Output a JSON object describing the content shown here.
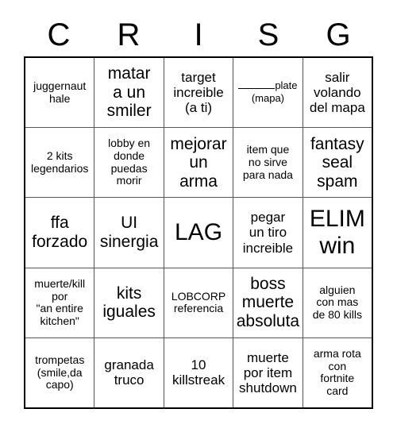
{
  "card": {
    "title_letters": [
      "C",
      "R",
      "I",
      "S",
      "G"
    ],
    "columns": 5,
    "rows": 5,
    "border_color": "#000000",
    "grid_line_color": "#555555",
    "background_color": "#ffffff",
    "text_color": "#000000",
    "cells": [
      [
        {
          "text": "juggernaut\nhale",
          "size": "sm"
        },
        {
          "text": "matar\na un\nsmiler",
          "size": "lg"
        },
        {
          "text": "target\nincreible\n(a ti)",
          "size": "md"
        },
        {
          "type": "fill-in-blank",
          "blank_suffix": "plate",
          "sub_text": "(mapa)",
          "size": "xs"
        },
        {
          "text": "salir\nvolando\ndel mapa",
          "size": "md"
        }
      ],
      [
        {
          "text": "2 kits\nlegendarios",
          "size": "sm"
        },
        {
          "text": "lobby en\ndonde\npuedas\nmorir",
          "size": "sm"
        },
        {
          "text": "mejorar\nun\narma",
          "size": "lg"
        },
        {
          "text": "item que\nno sirve\npara nada",
          "size": "sm"
        },
        {
          "text": "fantasy\nseal\nspam",
          "size": "lg"
        }
      ],
      [
        {
          "text": "ffa\nforzado",
          "size": "lg"
        },
        {
          "text": "UI\nsinergia",
          "size": "lg"
        },
        {
          "text": "LAG",
          "size": "xl"
        },
        {
          "text": "pegar\nun tiro\nincreible",
          "size": "md"
        },
        {
          "text": "ELIM\nwin",
          "size": "xl"
        }
      ],
      [
        {
          "text": "muerte/kill\npor\n\"an entire\nkitchen\"",
          "size": "sm"
        },
        {
          "text": "kits\niguales",
          "size": "lg"
        },
        {
          "text": "LOBCORP\nreferencia",
          "size": "sm"
        },
        {
          "text": "boss\nmuerte\nabsoluta",
          "size": "lg"
        },
        {
          "text": "alguien\ncon mas\nde 80 kills",
          "size": "sm"
        }
      ],
      [
        {
          "text": "trompetas\n(smile,da\ncapo)",
          "size": "sm"
        },
        {
          "text": "granada\ntruco",
          "size": "md"
        },
        {
          "text": "10\nkillstreak",
          "size": "md"
        },
        {
          "text": "muerte\npor item\nshutdown",
          "size": "md"
        },
        {
          "text": "arma rota\ncon\nfortnite\ncard",
          "size": "sm"
        }
      ]
    ]
  }
}
